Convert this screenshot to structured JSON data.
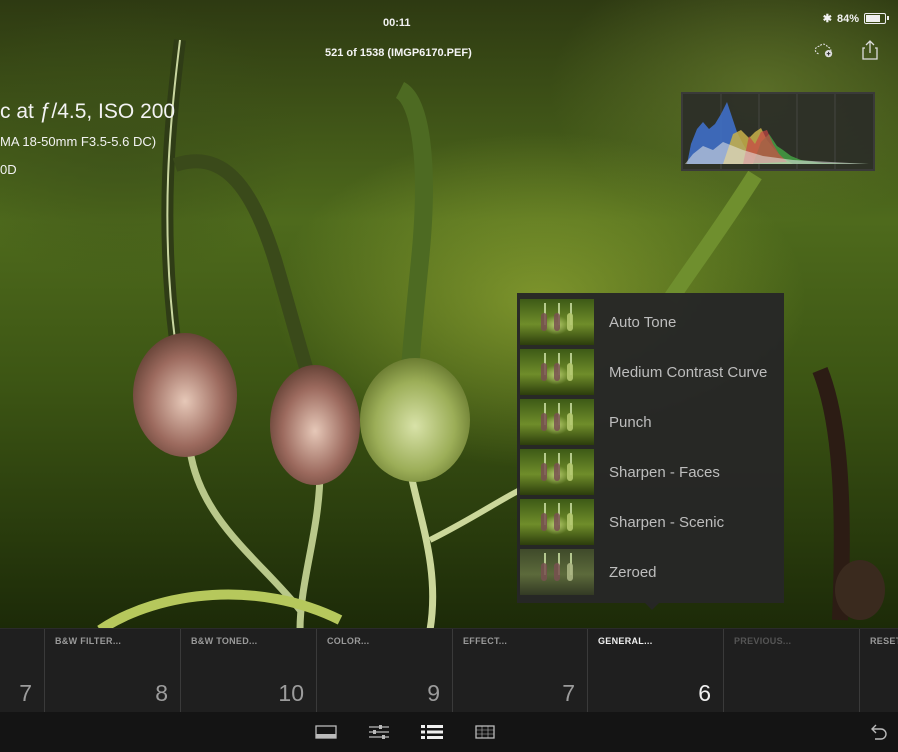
{
  "status_bar": {
    "time": "00:11",
    "battery": "84%",
    "bluetooth_icon": "bluetooth-icon",
    "battery_icon": "battery-icon"
  },
  "header": {
    "title": "521 of 1538 (IMGP6170.PEF)",
    "icons": [
      "cloud-add-icon",
      "share-icon"
    ]
  },
  "exif": {
    "line1": "c at ƒ/4.5, ISO 200",
    "line2": "MA 18-50mm F3.5-5.6 DC)",
    "line3": "0D"
  },
  "presets": {
    "items": [
      {
        "label": "Auto Tone"
      },
      {
        "label": "Medium Contrast Curve"
      },
      {
        "label": "Punch"
      },
      {
        "label": "Sharpen - Faces"
      },
      {
        "label": "Sharpen - Scenic"
      },
      {
        "label": "Zeroed"
      }
    ]
  },
  "categories": {
    "items": [
      {
        "label": "",
        "count": "7"
      },
      {
        "label": "B&W FILTER...",
        "count": "8"
      },
      {
        "label": "B&W TONED...",
        "count": "10"
      },
      {
        "label": "COLOR...",
        "count": "9"
      },
      {
        "label": "EFFECT...",
        "count": "7"
      },
      {
        "label": "GENERAL...",
        "count": "6",
        "active": true
      },
      {
        "label": "PREVIOUS...",
        "count": "",
        "dim": true
      },
      {
        "label": "RESET",
        "count": ""
      }
    ]
  },
  "toolbar": {
    "icons": [
      "filmstrip-icon",
      "adjust-sliders-icon",
      "presets-list-icon",
      "crop-icon",
      "undo-icon"
    ]
  },
  "colors": {
    "panel_bg": "#262626",
    "category_bg": "#1f1f1f",
    "toolbar_bg": "#141414",
    "histogram_blue": "#3f6fc8",
    "histogram_yellow": "#c8b24a",
    "histogram_green": "#46a846",
    "histogram_red": "#c84646"
  }
}
